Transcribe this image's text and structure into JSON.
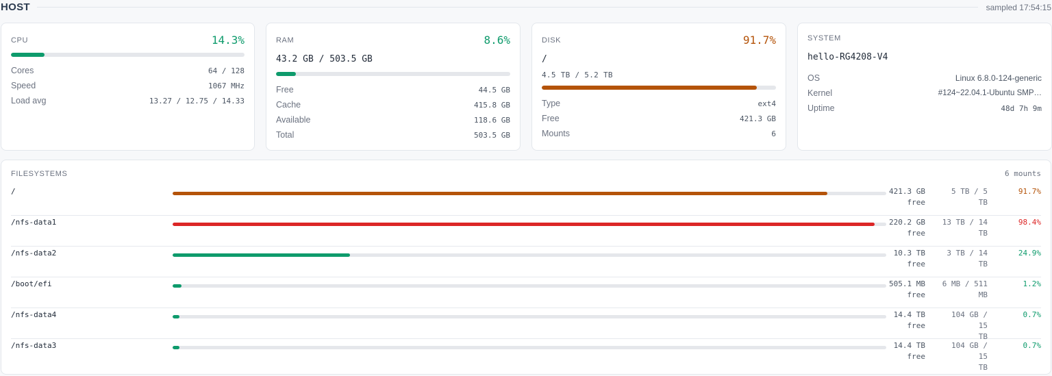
{
  "header": {
    "title": "HOST",
    "sampled": "sampled 17:54:15"
  },
  "colors": {
    "green": "#0e9b6c",
    "orange": "#b45309",
    "red": "#dc2626",
    "track": "#e5e7eb"
  },
  "cpu": {
    "label": "CPU",
    "pct": "14.3%",
    "usage_fraction": 0.143,
    "rows": [
      {
        "k": "Cores",
        "v": "64 / 128"
      },
      {
        "k": "Speed",
        "v": "1067 MHz"
      },
      {
        "k": "Load avg",
        "v": "13.27 / 12.75 / 14.33"
      }
    ]
  },
  "ram": {
    "label": "RAM",
    "pct": "8.6%",
    "usage_fraction": 0.086,
    "summary": "43.2 GB / 503.5 GB",
    "rows": [
      {
        "k": "Free",
        "v": "44.5 GB"
      },
      {
        "k": "Cache",
        "v": "415.8 GB"
      },
      {
        "k": "Available",
        "v": "118.6 GB"
      },
      {
        "k": "Total",
        "v": "503.5 GB"
      }
    ]
  },
  "disk": {
    "label": "DISK",
    "pct": "91.7%",
    "usage_fraction": 0.917,
    "mount": "/",
    "summary": "4.5 TB / 5.2 TB",
    "rows": [
      {
        "k": "Type",
        "v": "ext4"
      },
      {
        "k": "Free",
        "v": "421.3 GB"
      },
      {
        "k": "Mounts",
        "v": "6"
      }
    ]
  },
  "system": {
    "label": "SYSTEM",
    "hostname": "hello-RG4208-V4",
    "rows": [
      {
        "k": "OS",
        "v": "Linux 6.8.0-124-generic"
      },
      {
        "k": "Kernel",
        "v": "#124~22.04.1-Ubuntu SMP…"
      },
      {
        "k": "Uptime",
        "v": "48d 7h 9m"
      }
    ]
  },
  "filesystems": {
    "label": "FILESYSTEMS",
    "count": "6 mounts",
    "rows": [
      {
        "mount": "/",
        "free1": "421.3 GB",
        "free2": "free",
        "total1": "5 TB / 5 TB",
        "total2": "",
        "pct": "91.7%",
        "usage_fraction": 0.917,
        "status": "orange"
      },
      {
        "mount": "/nfs-data1",
        "free1": "220.2 GB",
        "free2": "free",
        "total1": "13 TB / 14",
        "total2": "TB",
        "pct": "98.4%",
        "usage_fraction": 0.984,
        "status": "red"
      },
      {
        "mount": "/nfs-data2",
        "free1": "10.3 TB",
        "free2": "free",
        "total1": "3 TB / 14 TB",
        "total2": "",
        "pct": "24.9%",
        "usage_fraction": 0.249,
        "status": "green"
      },
      {
        "mount": "/boot/efi",
        "free1": "505.1 MB",
        "free2": "free",
        "total1": "6 MB / 511",
        "total2": "MB",
        "pct": "1.2%",
        "usage_fraction": 0.012,
        "status": "green"
      },
      {
        "mount": "/nfs-data4",
        "free1": "14.4 TB",
        "free2": "free",
        "total1": "104 GB / 15",
        "total2": "TB",
        "pct": "0.7%",
        "usage_fraction": 0.007,
        "status": "green"
      },
      {
        "mount": "/nfs-data3",
        "free1": "14.4 TB",
        "free2": "free",
        "total1": "104 GB / 15",
        "total2": "TB",
        "pct": "0.7%",
        "usage_fraction": 0.007,
        "status": "green"
      }
    ]
  }
}
